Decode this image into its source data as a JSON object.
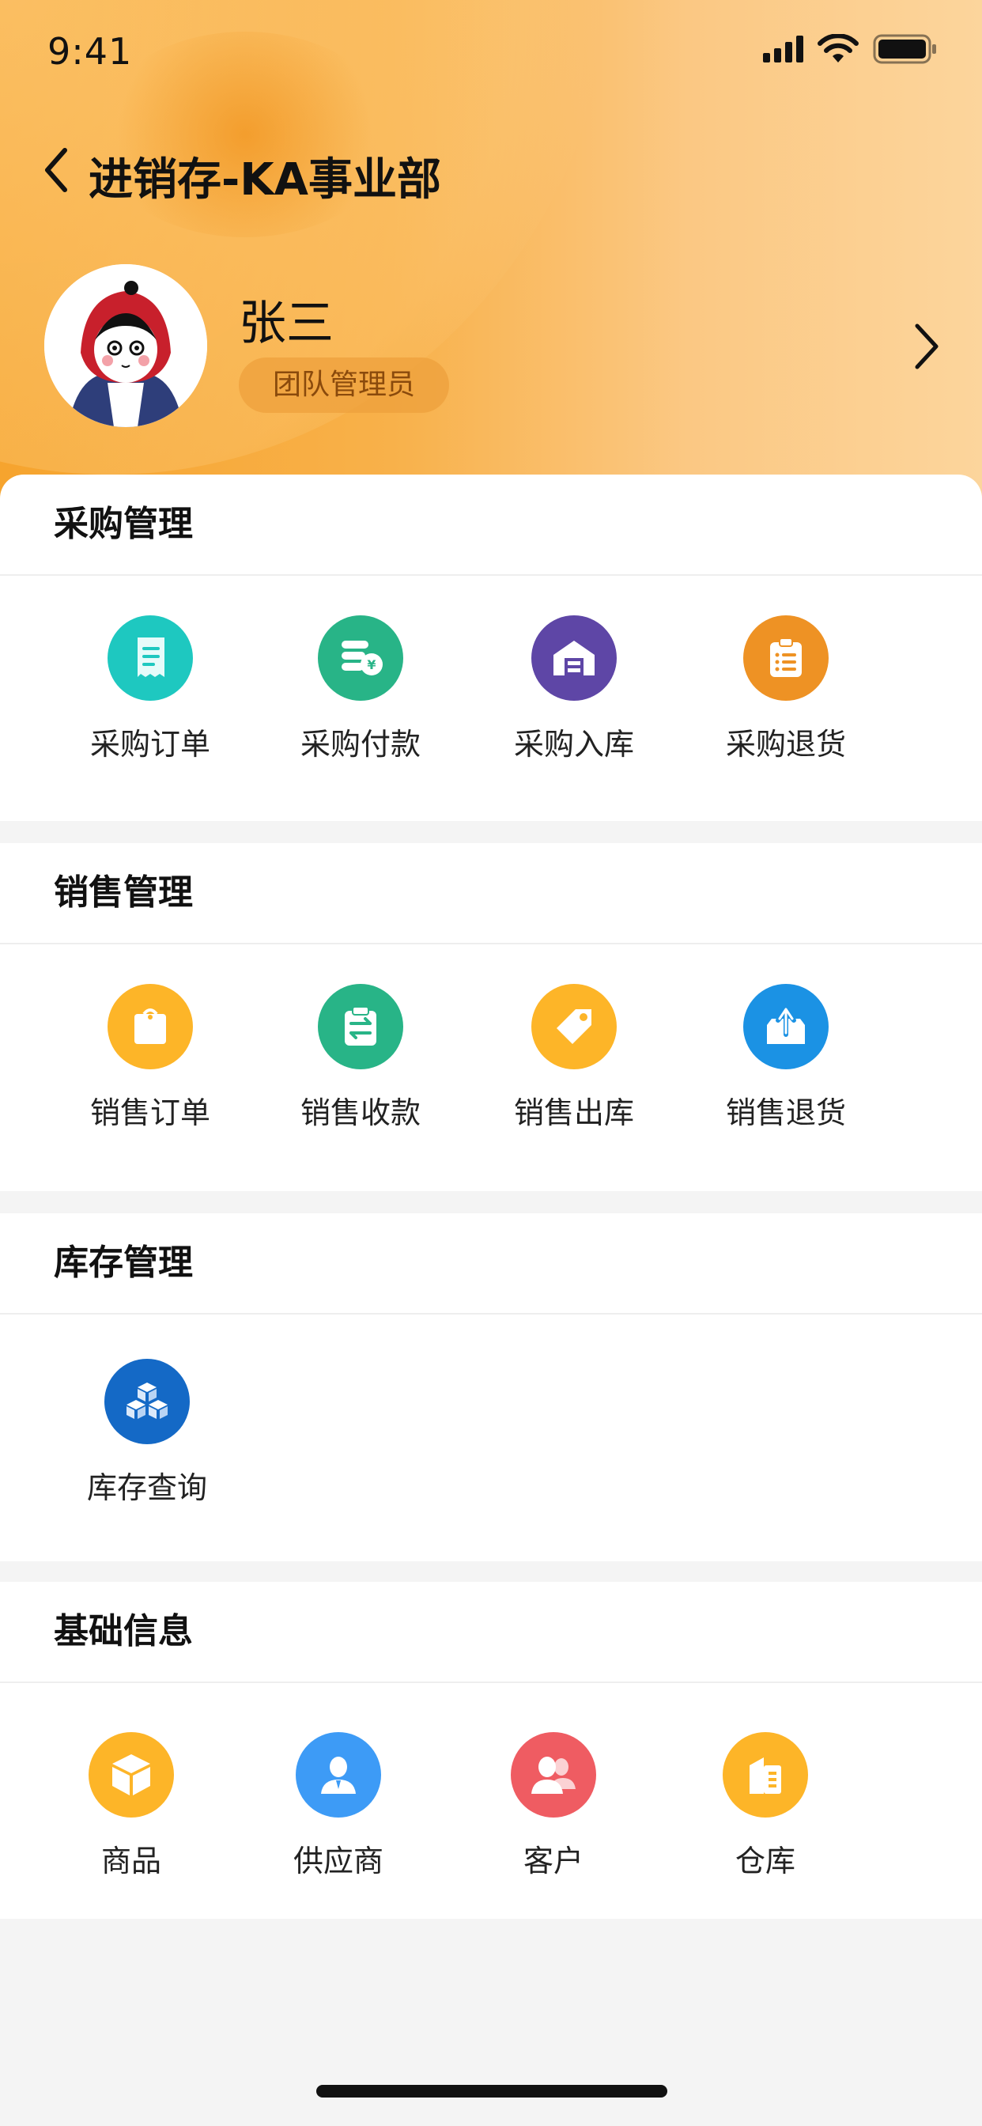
{
  "status_bar": {
    "time": "9:41"
  },
  "nav": {
    "title": "进销存-KA事业部"
  },
  "profile": {
    "name": "张三",
    "role": "团队管理员"
  },
  "sections": [
    {
      "title": "采购管理",
      "items": [
        {
          "label": "采购订单",
          "icon": "receipt-icon",
          "color": "#1ec8c0"
        },
        {
          "label": "采购付款",
          "icon": "coins-yen-icon",
          "color": "#28b487"
        },
        {
          "label": "采购入库",
          "icon": "warehouse-icon",
          "color": "#5e46a6"
        },
        {
          "label": "采购退货",
          "icon": "clipboard-list-icon",
          "color": "#ee9224"
        }
      ]
    },
    {
      "title": "销售管理",
      "items": [
        {
          "label": "销售订单",
          "icon": "bag-icon",
          "color": "#fdb528"
        },
        {
          "label": "销售收款",
          "icon": "transfer-icon",
          "color": "#28b487"
        },
        {
          "label": "销售出库",
          "icon": "tag-icon",
          "color": "#fdb528"
        },
        {
          "label": "销售退货",
          "icon": "box-upload-icon",
          "color": "#1b92e4"
        }
      ]
    },
    {
      "title": "库存管理",
      "items": [
        {
          "label": "库存查询",
          "icon": "cubes-icon",
          "color": "#1469c6"
        }
      ]
    },
    {
      "title": "基础信息",
      "items": [
        {
          "label": "商品",
          "icon": "package-icon",
          "color": "#fdb528"
        },
        {
          "label": "供应商",
          "icon": "person-icon",
          "color": "#3d9bf6"
        },
        {
          "label": "客户",
          "icon": "people-icon",
          "color": "#ef5c62"
        },
        {
          "label": "仓库",
          "icon": "building-icon",
          "color": "#fdb528"
        }
      ]
    }
  ]
}
